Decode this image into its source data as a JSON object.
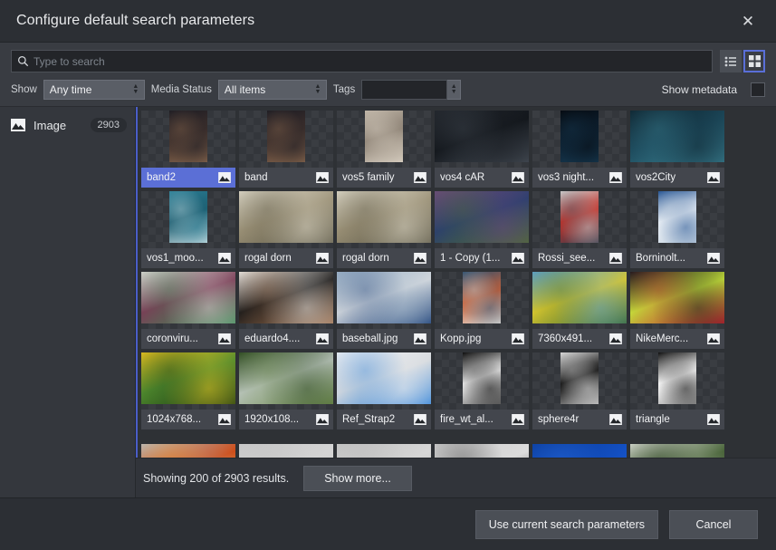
{
  "window": {
    "title": "Configure default search parameters",
    "close_label": "✕"
  },
  "search": {
    "placeholder": "Type to search",
    "value": "",
    "icon": "search-icon"
  },
  "view_toggle": {
    "list_label": "list-view-icon",
    "grid_label": "grid-view-icon",
    "selected": "grid"
  },
  "filters": {
    "show_label": "Show",
    "show_value": "Any time",
    "media_status_label": "Media Status",
    "media_status_value": "All items",
    "tags_label": "Tags",
    "tags_value": "",
    "show_metadata_label": "Show metadata",
    "show_metadata_checked": false
  },
  "sidebar": {
    "items": [
      {
        "label": "Image",
        "count": "2903",
        "icon": "image-icon"
      }
    ]
  },
  "grid": {
    "items": [
      {
        "label": "band2",
        "selected": true,
        "aspect": "portrait",
        "colors": [
          "#1a1a22",
          "#3c2f2c",
          "#8d6a4f"
        ]
      },
      {
        "label": "band",
        "selected": false,
        "aspect": "portrait",
        "colors": [
          "#1a1a22",
          "#3c2f2c",
          "#8d6a4f"
        ]
      },
      {
        "label": "vos5 family",
        "selected": false,
        "aspect": "portrait",
        "colors": [
          "#bdb3a5",
          "#8d8275",
          "#d8cfc2"
        ]
      },
      {
        "label": "vos4 cAR",
        "selected": false,
        "aspect": "wide",
        "colors": [
          "#20242a",
          "#12161b",
          "#454c55"
        ]
      },
      {
        "label": "vos3 night...",
        "selected": false,
        "aspect": "portrait",
        "colors": [
          "#05090f",
          "#0d2030",
          "#173a52"
        ]
      },
      {
        "label": "vos2City",
        "selected": false,
        "aspect": "wide",
        "colors": [
          "#0d222e",
          "#1d4a5c",
          "#3a7f90"
        ]
      },
      {
        "label": "vos1_moo...",
        "selected": false,
        "aspect": "portrait",
        "colors": [
          "#2b7f96",
          "#1c5d70",
          "#cfe2e6"
        ]
      },
      {
        "label": "rogal dorn",
        "selected": false,
        "aspect": "wide",
        "colors": [
          "#ddd8c8",
          "#9a9076",
          "#5e5a48"
        ]
      },
      {
        "label": "rogal dorn",
        "selected": false,
        "aspect": "wide",
        "colors": [
          "#ddd8c8",
          "#9a9076",
          "#5e5a48"
        ]
      },
      {
        "label": "1 - Copy (1...",
        "selected": false,
        "aspect": "wide",
        "colors": [
          "#6a4a7a",
          "#2b3f6e",
          "#4d6a35"
        ]
      },
      {
        "label": "Rossi_see...",
        "selected": false,
        "aspect": "portrait",
        "colors": [
          "#cfcfcf",
          "#c0332b",
          "#3b3b4a"
        ]
      },
      {
        "label": "Borninolt...",
        "selected": false,
        "aspect": "portrait",
        "colors": [
          "#1f4f8f",
          "#e8eef5",
          "#c9d6e2"
        ]
      },
      {
        "label": "coronviru...",
        "selected": false,
        "aspect": "wide",
        "colors": [
          "#d8d6d2",
          "#7a3d56",
          "#3f8a57"
        ]
      },
      {
        "label": "eduardo4....",
        "selected": false,
        "aspect": "wide",
        "colors": [
          "#e8e6e2",
          "#1d1b1a",
          "#9c6f4e"
        ]
      },
      {
        "label": "baseball.jpg",
        "selected": false,
        "aspect": "wide",
        "colors": [
          "#9fb4c8",
          "#d4d9de",
          "#1b3f77"
        ]
      },
      {
        "label": "Kopp.jpg",
        "selected": false,
        "aspect": "portrait",
        "colors": [
          "#2e4f6e",
          "#c2603a",
          "#e8e4dd"
        ]
      },
      {
        "label": "7360x491...",
        "selected": false,
        "aspect": "wide",
        "colors": [
          "#5fa3cc",
          "#d9c72e",
          "#3c6b33"
        ]
      },
      {
        "label": "NikeMerc...",
        "selected": false,
        "aspect": "wide",
        "colors": [
          "#1a1a1e",
          "#c4e03a",
          "#c0232f"
        ]
      },
      {
        "label": "1024x768...",
        "selected": false,
        "aspect": "wide",
        "colors": [
          "#e9c421",
          "#4f8a2e",
          "#1d3b12"
        ]
      },
      {
        "label": "1920x108...",
        "selected": false,
        "aspect": "wide",
        "colors": [
          "#2e4a22",
          "#b9c4bb",
          "#6d8a4c"
        ]
      },
      {
        "label": "Ref_Strap2",
        "selected": false,
        "aspect": "wide",
        "colors": [
          "#f0f1f3",
          "#d6dade",
          "#2c7fd6"
        ]
      },
      {
        "label": "fire_wt_al...",
        "selected": false,
        "aspect": "portrait",
        "colors": [
          "#0b0b0b",
          "#efefef",
          "#6b6b6b"
        ]
      },
      {
        "label": "sphere4r",
        "selected": false,
        "aspect": "portrait",
        "colors": [
          "#d9d9d9",
          "#0a0a0a",
          "#b3b3b3"
        ]
      },
      {
        "label": "triangle",
        "selected": false,
        "aspect": "portrait",
        "colors": [
          "#0a0a0a",
          "#ffffff",
          "#9a9a9a"
        ]
      }
    ],
    "partial_row": [
      {
        "colors": [
          "#b7b7b7",
          "#d0430a",
          "#f0a43a"
        ]
      },
      {
        "colors": [
          "#c9c9c9",
          "#d6d6d6",
          "#bcbcbc"
        ]
      },
      {
        "colors": [
          "#c4c4c4",
          "#d9d9d9",
          "#b0b0b0"
        ]
      },
      {
        "colors": [
          "#cfcfcf",
          "#dedede",
          "#2b2b2b"
        ]
      },
      {
        "colors": [
          "#0c3fa0",
          "#1452c8",
          "#2a6ad6"
        ]
      },
      {
        "colors": [
          "#d8dcd2",
          "#3d5a2c",
          "#1f3318"
        ]
      }
    ]
  },
  "status": {
    "text": "Showing 200 of 2903 results.",
    "show_more_label": "Show more..."
  },
  "footer": {
    "use_params_label": "Use current search parameters",
    "cancel_label": "Cancel"
  },
  "colors": {
    "accent": "#5b6fd6",
    "window_bg": "#31343a",
    "titlebar_bg": "#2c2f34",
    "toolbar_bg": "#393c42",
    "grid_bg": "#2e3135",
    "caption_bg": "#43464d"
  }
}
